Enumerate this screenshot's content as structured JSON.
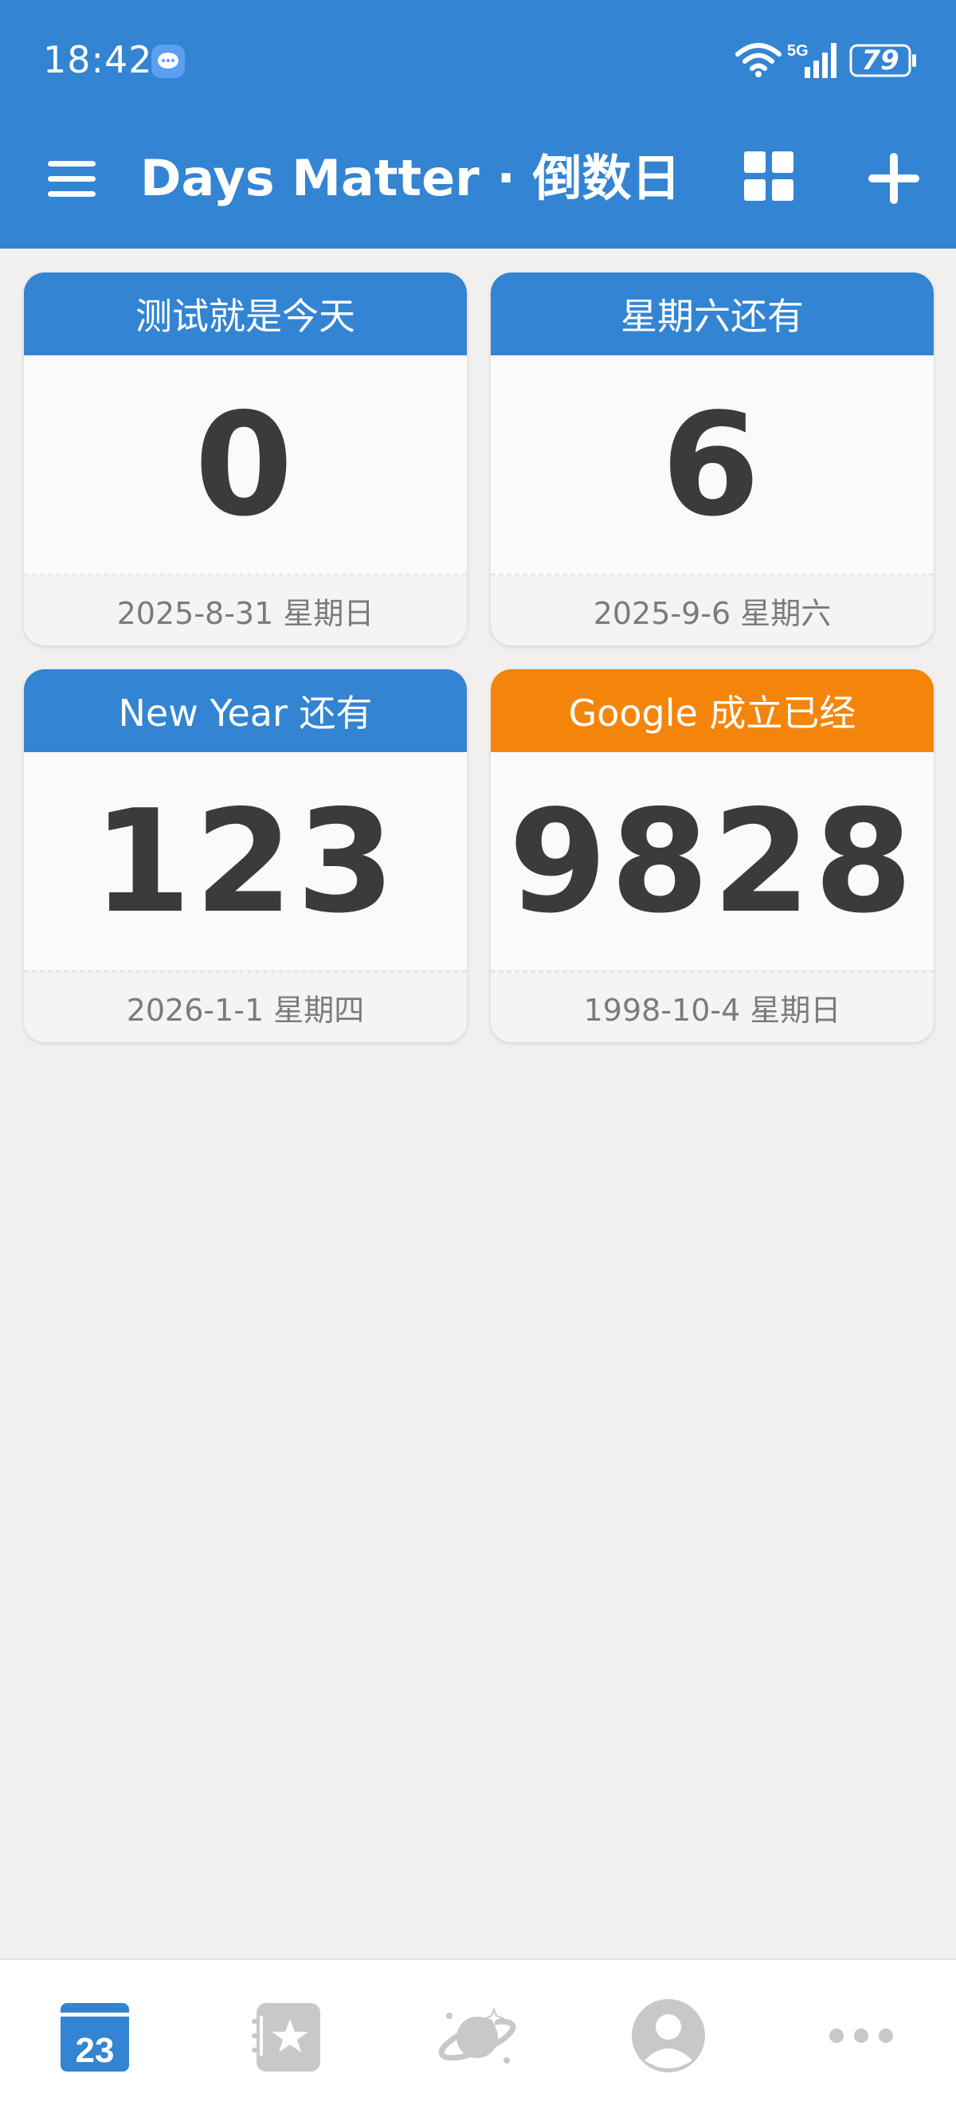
{
  "status_bar": {
    "time": "18:42",
    "battery": "79",
    "network": "5G"
  },
  "header": {
    "title": "Days Matter · 倒数日",
    "menu_icon": "hamburger-menu-icon",
    "grid_icon": "grid-view-icon",
    "add_icon": "plus-icon"
  },
  "colors": {
    "primary": "#3384d2",
    "accent_orange": "#f5850a",
    "number": "#3b3b3b",
    "date_text": "#7b7b7b",
    "background": "#f1f0ef"
  },
  "cards": [
    {
      "title": "测试就是今天",
      "days": "0",
      "date": "2025-8-31 星期日",
      "header_color": "#3384d2"
    },
    {
      "title": "星期六还有",
      "days": "6",
      "date": "2025-9-6 星期六",
      "header_color": "#3384d2"
    },
    {
      "title": "New Year 还有",
      "days": "123",
      "date": "2026-1-1 星期四",
      "header_color": "#3384d2"
    },
    {
      "title": "Google 成立已经",
      "days": "9828",
      "date": "1998-10-4 星期日",
      "header_color": "#f5850a"
    }
  ],
  "bottom_nav": {
    "items": [
      {
        "icon": "calendar-icon",
        "label": "23",
        "active": true
      },
      {
        "icon": "star-notebook-icon",
        "active": false
      },
      {
        "icon": "planet-icon",
        "active": false
      },
      {
        "icon": "profile-icon",
        "active": false
      },
      {
        "icon": "more-icon",
        "active": false
      }
    ]
  }
}
